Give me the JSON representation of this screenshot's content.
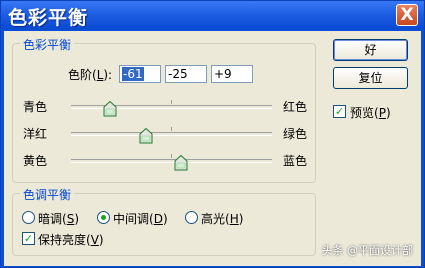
{
  "window": {
    "title": "色彩平衡",
    "close_glyph": "X"
  },
  "color_balance": {
    "legend": "色彩平衡",
    "levels_label": "色阶(",
    "levels_key": "L",
    "levels_label_end": "):",
    "levels": [
      "-61",
      "-25",
      "+9"
    ],
    "sliders": [
      {
        "left": "青色",
        "right": "红色",
        "value": -61
      },
      {
        "left": "洋红",
        "right": "绿色",
        "value": -25
      },
      {
        "left": "黄色",
        "right": "蓝色",
        "value": 9
      }
    ],
    "slider_range": [
      -100,
      100
    ]
  },
  "tone_balance": {
    "legend": "色调平衡",
    "options": [
      {
        "label": "暗调(",
        "key": "S",
        "end": ")",
        "selected": false
      },
      {
        "label": "中间调(",
        "key": "D",
        "end": ")",
        "selected": true
      },
      {
        "label": "高光(",
        "key": "H",
        "end": ")",
        "selected": false
      }
    ],
    "preserve_label": "保持亮度(",
    "preserve_key": "V",
    "preserve_end": ")",
    "preserve_checked": true
  },
  "buttons": {
    "ok": "好",
    "reset": "复位"
  },
  "preview": {
    "label": "预览(",
    "key": "P",
    "end": ")",
    "checked": true
  },
  "watermark": "头条 @平面设计部"
}
